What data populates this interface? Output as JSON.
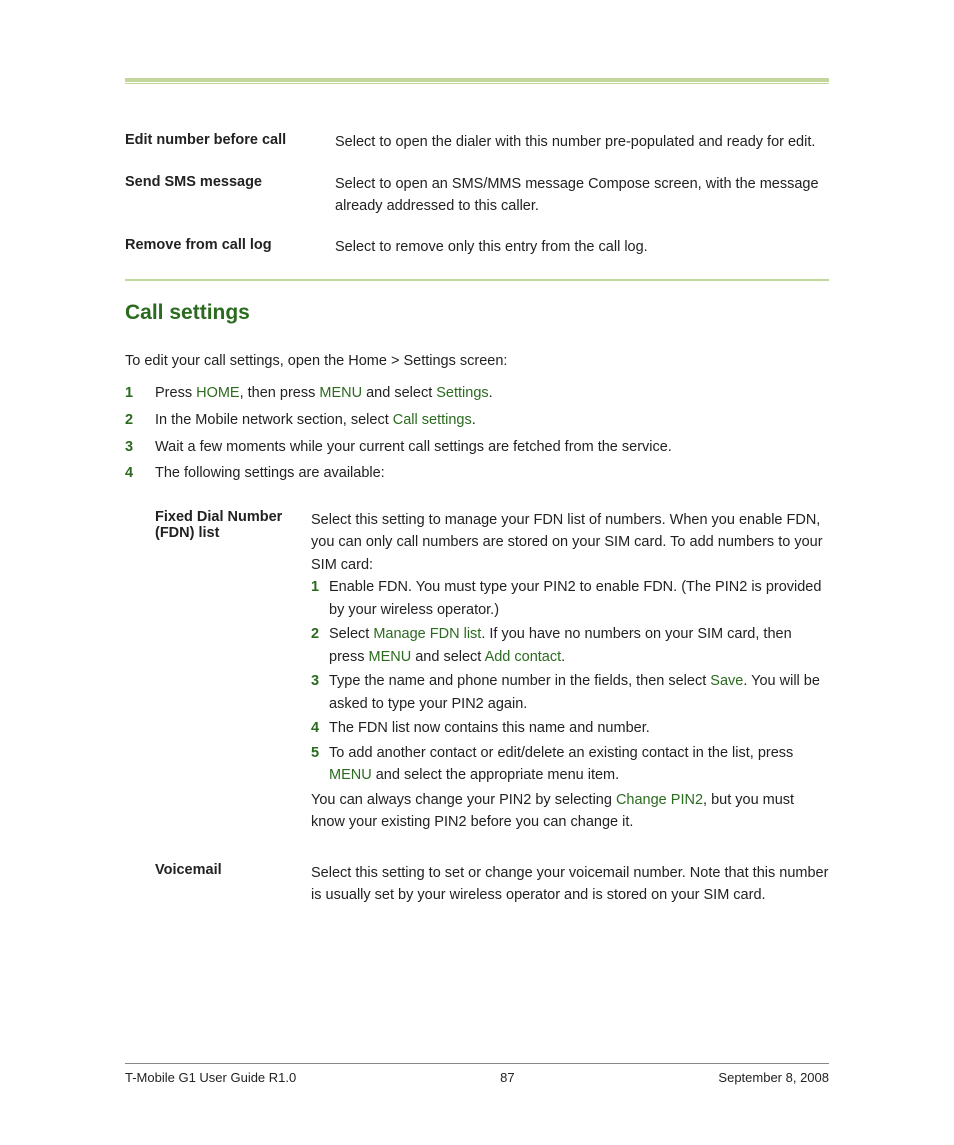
{
  "defs": [
    {
      "term": "Edit number before call",
      "desc": "Select to open the dialer with this number pre-populated and ready for edit."
    },
    {
      "term": "Send SMS message",
      "desc": "Select to open an SMS/MMS message Compose screen, with the message already addressed to this caller."
    },
    {
      "term": "Remove from call log",
      "desc": "Select to remove only this entry from the call log."
    }
  ],
  "section_title": "Call settings",
  "intro": "To edit your call settings, open the Home > Settings screen:",
  "steps": {
    "s1": {
      "num": "1",
      "pre": "Press ",
      "kw1": "HOME",
      "mid1": ", then press ",
      "kw2": "MENU",
      "mid2": " and select ",
      "kw3": "Settings",
      "post": "."
    },
    "s2": {
      "num": "2",
      "pre": "In the Mobile network section, select ",
      "kw1": "Call settings",
      "post": "."
    },
    "s3": {
      "num": "3",
      "txt": "Wait a few moments while your current call settings are fetched from the service."
    },
    "s4": {
      "num": "4",
      "txt": "The following settings are available:"
    }
  },
  "fdn": {
    "term": "Fixed Dial Number (FDN) list",
    "lead": "Select this setting to manage your FDN list of numbers. When you enable FDN, you can only call numbers are stored on your SIM card. To add numbers to your SIM card:",
    "i1": {
      "num": "1",
      "txt": "Enable FDN. You must type your PIN2 to enable FDN. (The PIN2 is provided by your wireless operator.)"
    },
    "i2": {
      "num": "2",
      "pre": "Select ",
      "kw1": "Manage FDN list",
      "mid1": ". If you have no numbers on your SIM card, then press ",
      "kw2": "MENU",
      "mid2": " and select ",
      "kw3": "Add contact",
      "post": "."
    },
    "i3": {
      "num": "3",
      "pre": "Type the name and phone number in the fields, then select ",
      "kw1": "Save",
      "post": ". You will be asked to type your PIN2 again."
    },
    "i4": {
      "num": "4",
      "txt": "The FDN list now contains this name and number."
    },
    "i5": {
      "num": "5",
      "pre": "To add another contact or edit/delete an existing contact in the list, press ",
      "kw1": "MENU",
      "post": " and select the appropriate menu item."
    },
    "trail_pre": "You can always change your PIN2 by selecting ",
    "trail_kw": "Change PIN2",
    "trail_post": ", but you must know your existing PIN2 before you can change it."
  },
  "voicemail": {
    "term": "Voicemail",
    "desc": "Select this setting to set or change your voicemail number. Note that this number is usually set by your wireless operator and is stored on your SIM card."
  },
  "footer": {
    "left": "T-Mobile G1 User Guide R1.0",
    "center": "87",
    "right": "September 8, 2008"
  }
}
